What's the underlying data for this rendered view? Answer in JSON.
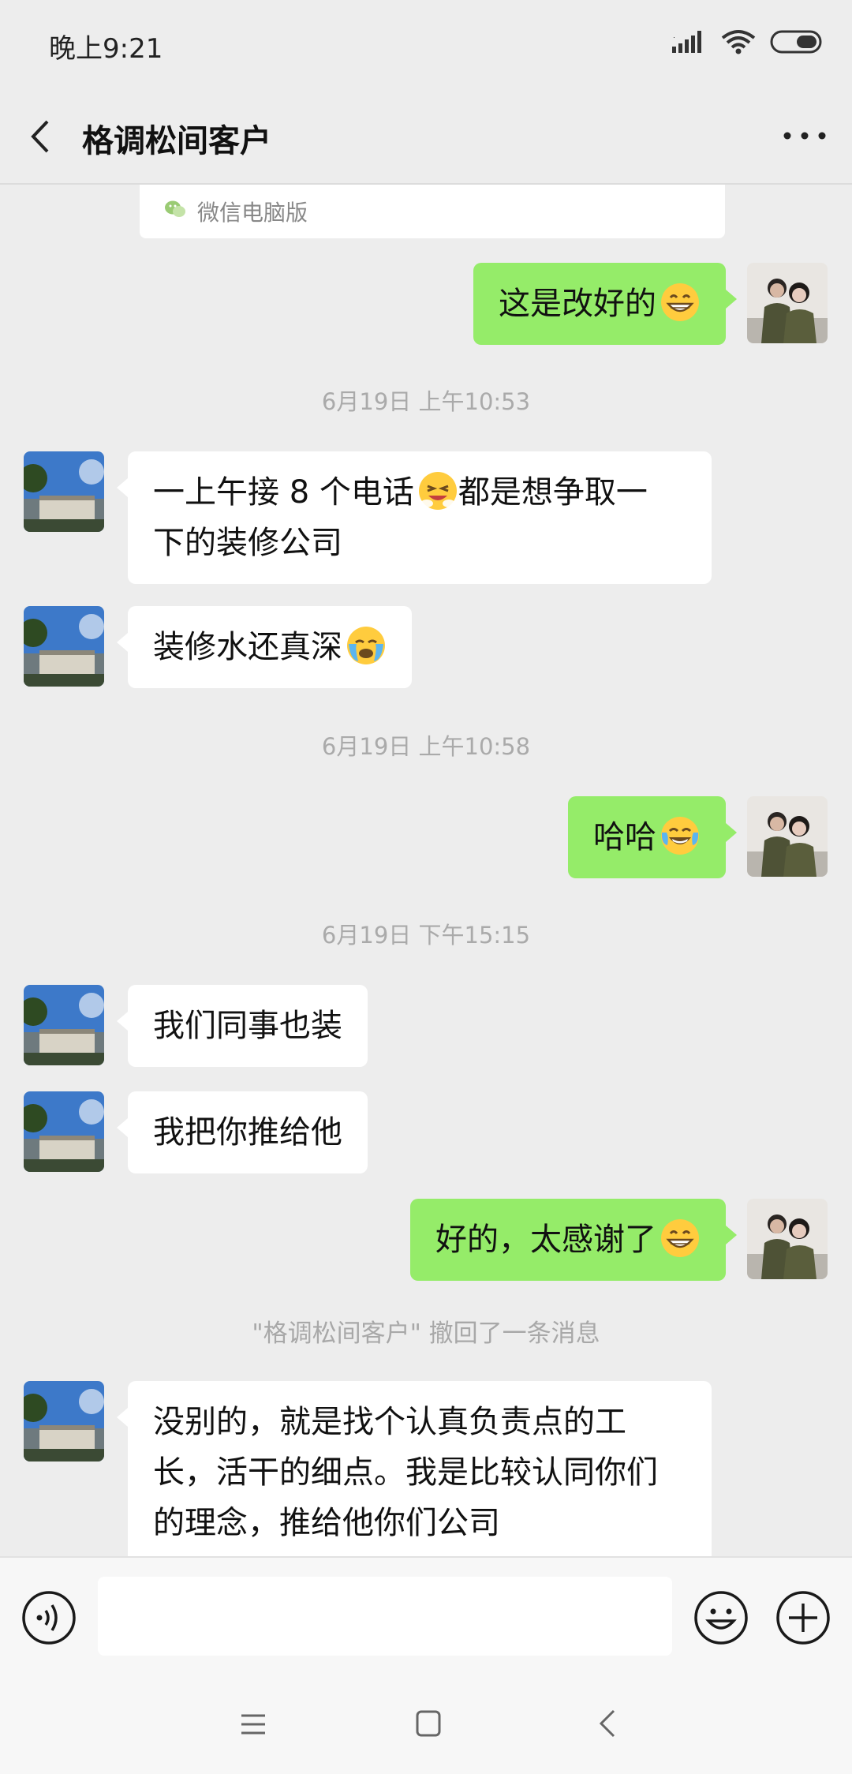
{
  "status_bar": {
    "time": "晚上9:21"
  },
  "header": {
    "title": "格调松间客户"
  },
  "card": {
    "text": "微信电脑版"
  },
  "messages": {
    "m1": "这是改好的",
    "ts1": "6月19日 上午10:53",
    "m2_line1": "一上午接 8 个电话",
    "m2_line1b": "都是想争取一",
    "m2_line2": "下的装修公司",
    "m3": "装修水还真深",
    "ts2": "6月19日 上午10:58",
    "m4": "哈哈",
    "ts3": "6月19日 下午15:15",
    "m5": "我们同事也装",
    "m6": "我把你推给他",
    "m7": "好的，太感谢了",
    "notice": "\"格调松间客户\" 撤回了一条消息",
    "m8_line1": "没别的，就是找个认真负责点的工",
    "m8_line2": "长，活干的细点。我是比较认同你们",
    "m8_line3": "的理念，推给他你们公司"
  },
  "colors": {
    "background": "#EDEDED",
    "sent_bubble": "#95EC69",
    "received_bubble": "#FFFFFF"
  },
  "icons": {
    "back": "chevron-left-icon",
    "more": "more-dots-icon",
    "voice": "voice-icon",
    "emoji": "emoji-icon",
    "plus": "plus-icon"
  }
}
